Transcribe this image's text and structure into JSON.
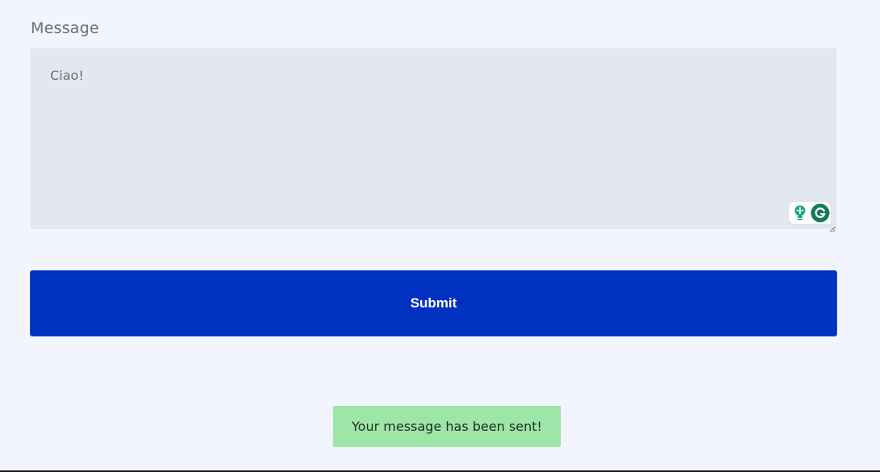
{
  "form": {
    "message_label": "Message",
    "message_value": "Ciao!",
    "submit_label": "Submit"
  },
  "notification": {
    "text": "Your message has been sent!"
  },
  "icons": {
    "grammarly_suggestion": "lightbulb-icon",
    "grammarly_logo": "grammarly-g-icon"
  },
  "colors": {
    "submit_button": "#0131c1",
    "success_banner": "#9ee6a8",
    "page_background": "#f2f5fd",
    "textarea_background": "#e2e7f0"
  }
}
